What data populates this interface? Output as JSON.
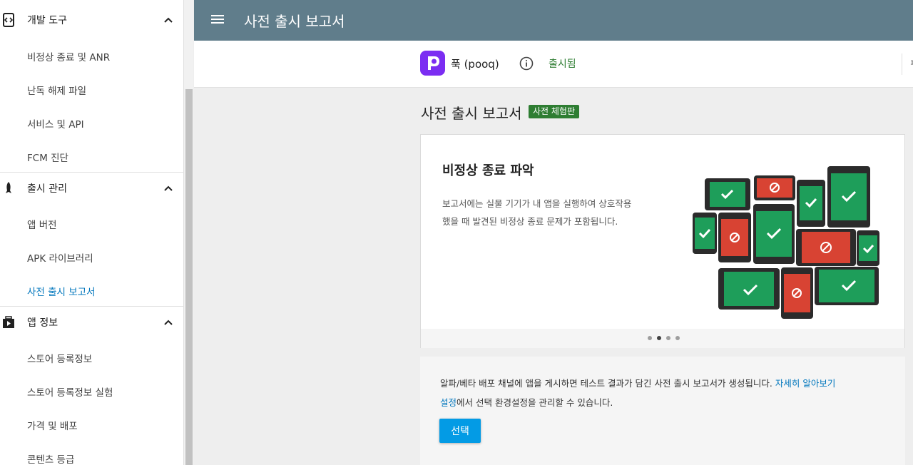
{
  "topbar": {
    "title": "사전 출시 보고서"
  },
  "sidebar": {
    "sections": [
      {
        "label": "개발 도구",
        "icon": "code-icon",
        "items": [
          "비정상 종료 및 ANR",
          "난독 해제 파일",
          "서비스 및 API",
          "FCM 진단"
        ]
      },
      {
        "label": "출시 관리",
        "icon": "rocket-icon",
        "items": [
          "앱 버전",
          "APK 라이브러리",
          "사전 출시 보고서"
        ]
      },
      {
        "label": "앱 정보",
        "icon": "play-store-icon",
        "items": [
          "스토어 등록정보",
          "스토어 등록정보 실험",
          "가격 및 배포",
          "콘텐츠 등급"
        ]
      }
    ],
    "active_item": "사전 출시 보고서"
  },
  "app": {
    "name": "푹 (pooq)",
    "status": "출시됨",
    "status_color": "#2e7d32",
    "right_cut_text": "ㅍ"
  },
  "page": {
    "title": "사전 출시 보고서",
    "badge": "사전 체험판"
  },
  "card": {
    "heading": "비정상 종료 파악",
    "body_line1": "보고서에는 실물 기기가 내 앱을 실행하여 상호작용",
    "body_line2": "했을 때 발견된 비정상 종료 문제가 포함됩니다.",
    "dots": 4,
    "active_dot": 1
  },
  "panel": {
    "text_line1": "알파/베타 배포 채널에 앱을 게시하면 테스트 결과가 담긴 사전 출시 보고서가 생성됩니다. ",
    "learn_more": "자세히 알아보기",
    "settings_link": "설정",
    "text_line2": "에서 선택 환경설정을 관리할 수 있습니다.",
    "button": "선택"
  },
  "colors": {
    "topbar": "#607d8b",
    "accent": "#039be5",
    "ok": "#1e9e5a",
    "crash": "#d84333",
    "device": "#2b2b2b"
  }
}
